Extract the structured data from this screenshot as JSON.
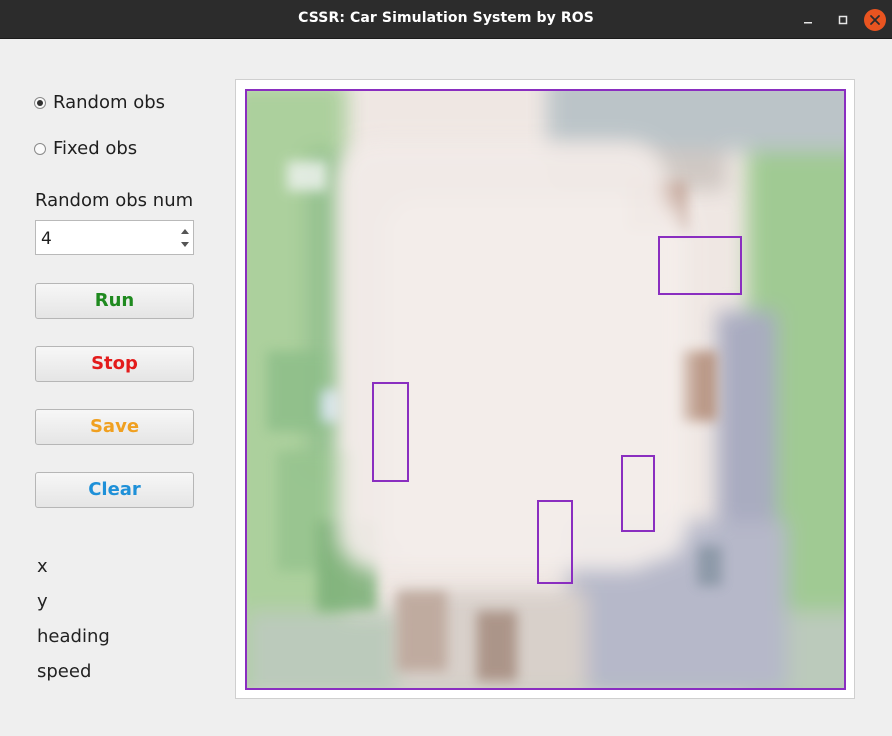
{
  "window": {
    "title": "CSSR: Car Simulation System by ROS",
    "controls": {
      "minimize_icon": "minimize-icon",
      "maximize_icon": "maximize-icon",
      "close_icon": "close-icon"
    }
  },
  "options": {
    "random_obs": {
      "label": "Random obs",
      "selected": true
    },
    "fixed_obs": {
      "label": "Fixed obs",
      "selected": false
    }
  },
  "random_obs_num": {
    "label": "Random obs num",
    "value": "4"
  },
  "buttons": {
    "run": {
      "label": "Run",
      "color": "#1f8a1f"
    },
    "stop": {
      "label": "Stop",
      "color": "#e31b1b"
    },
    "save": {
      "label": "Save",
      "color": "#f0a020"
    },
    "clear": {
      "label": "Clear",
      "color": "#1e90d8"
    }
  },
  "status": {
    "x_label": "x",
    "y_label": "y",
    "heading_label": "heading",
    "speed_label": "speed"
  },
  "map": {
    "obstacle_color": "#8a2ec0"
  }
}
